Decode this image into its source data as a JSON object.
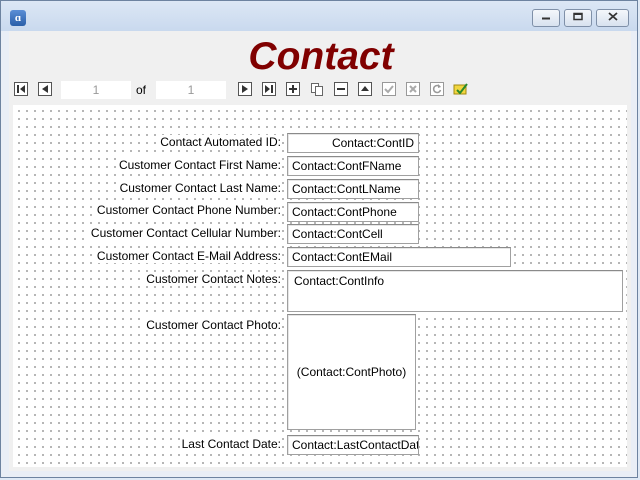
{
  "window": {
    "icon": "app-icon",
    "controls": [
      "minimize-icon",
      "maximize-icon",
      "close-icon"
    ]
  },
  "form": {
    "title": "Contact"
  },
  "toolbar": {
    "record_current": "1",
    "record_of_label": "of",
    "record_total": "1",
    "buttons": [
      "first-record-icon",
      "previous-record-icon",
      "next-record-icon",
      "last-record-icon",
      "add-icon",
      "copy-icon",
      "delete-icon",
      "change-icon",
      "save-icon",
      "cancel-icon",
      "refresh-icon",
      "lookup-icon"
    ]
  },
  "fields": [
    {
      "label": "Contact Automated ID:",
      "value": "Contact:ContID"
    },
    {
      "label": "Customer Contact First Name:",
      "value": "Contact:ContFName"
    },
    {
      "label": "Customer Contact Last Name:",
      "value": "Contact:ContLName"
    },
    {
      "label": "Customer Contact Phone Number:",
      "value": "Contact:ContPhone"
    },
    {
      "label": "Customer Contact Cellular Number:",
      "value": "Contact:ContCell"
    },
    {
      "label": "Customer Contact E-Mail Address:",
      "value": "Contact:ContEMail"
    },
    {
      "label": "Customer Contact Notes:",
      "value": "Contact:ContInfo"
    },
    {
      "label": "Customer Contact Photo:",
      "value": "(Contact:ContPhoto)"
    },
    {
      "label": "Last Contact Date:",
      "value": "Contact:LastContactDate"
    }
  ],
  "colors": {
    "title": "#800000",
    "window_frame": "#6d83a0"
  }
}
